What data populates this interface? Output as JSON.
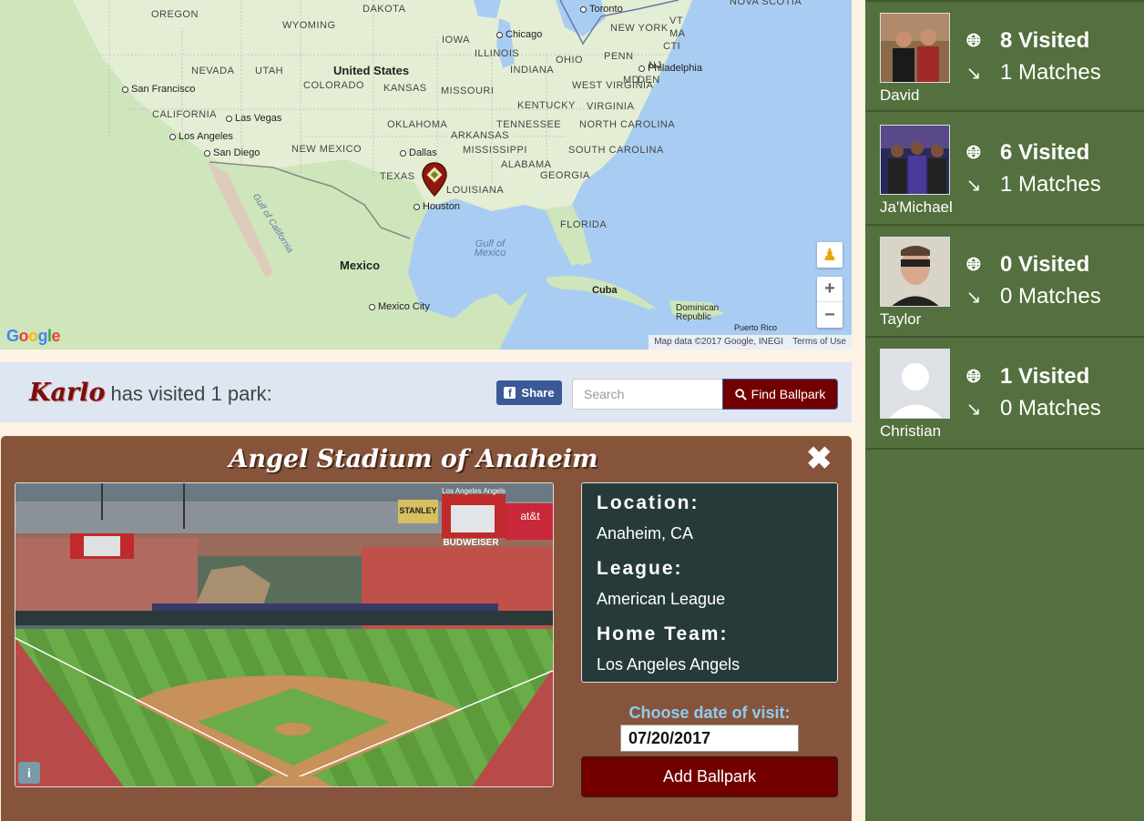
{
  "map": {
    "labels": {
      "oregon": "OREGON",
      "wyoming": "WYOMING",
      "dakota": "DAKOTA",
      "iowa": "IOWA",
      "nevada": "NEVADA",
      "utah": "UTAH",
      "colorado": "COLORADO",
      "kansas": "KANSAS",
      "missouri": "MISSOURI",
      "illinois": "ILLINOIS",
      "indiana": "INDIANA",
      "ohio": "OHIO",
      "penn": "PENN",
      "ny": "NEW YORK",
      "vt": "VT",
      "ma": "MA",
      "cti": "CTI",
      "nj": "NJ",
      "md": "MD",
      "de": "DEN",
      "california": "CALIFORNIA",
      "oklahoma": "OKLAHOMA",
      "tennessee": "TENNESSEE",
      "kentucky": "KENTUCKY",
      "westvirginia": "WEST VIRGINIA",
      "virginia": "VIRGINIA",
      "northcarolina": "NORTH CAROLINA",
      "southcarolina": "SOUTH CAROLINA",
      "arkansas": "ARKANSAS",
      "mississippi": "MISSISSIPPI",
      "alabama": "ALABAMA",
      "georgia": "GEORGIA",
      "newmexico": "NEW MEXICO",
      "texas": "TEXAS",
      "louisiana": "LOUISIANA",
      "florida": "FLORIDA",
      "novascotia": "NOVA SCOTIA",
      "us": "United States",
      "mexico": "Mexico",
      "cuba": "Cuba",
      "dr": "Dominican Republic",
      "pr": "Puerto Rico",
      "gulf": "Gulf of Mexico",
      "gulfcal": "Gulf of California",
      "chicago": "Chicago",
      "toronto": "Toronto",
      "philadelphia": "Philadelphia",
      "sanfrancisco": "San Francisco",
      "lasvegas": "Las Vegas",
      "losangeles": "Los Angeles",
      "sandiego": "San Diego",
      "dallas": "Dallas",
      "houston": "Houston",
      "mexicocity": "Mexico City"
    },
    "google": [
      "G",
      "o",
      "o",
      "g",
      "l",
      "e"
    ],
    "attribution": "Map data ©2017 Google, INEGI",
    "terms": "Terms of Use",
    "zoom_in": "+",
    "zoom_out": "−"
  },
  "banner": {
    "user_name": "Karlo",
    "visited_text": "has visited 1 park:",
    "share_label": "Share",
    "search_placeholder": "Search",
    "find_label": "Find Ballpark"
  },
  "park": {
    "name": "Angel Stadium of Anaheim",
    "close_symbol": "✖",
    "location_label": "Location:",
    "location_value": "Anaheim, CA",
    "league_label": "League:",
    "league_value": "American League",
    "team_label": "Home Team:",
    "team_value": "Los Angeles Angels",
    "date_label": "Choose date of visit:",
    "date_value": "07/20/2017",
    "add_label": "Add Ballpark",
    "photo_signs": {
      "stanley": "STANLEY",
      "angels": "Los Angeles Angels",
      "att": "at&t",
      "budweiser": "BUDWEISER"
    }
  },
  "friends": [
    {
      "name": "David",
      "visited": "8 Visited",
      "matches": "1 Matches"
    },
    {
      "name": "Ja'Michael",
      "visited": "6 Visited",
      "matches": "1 Matches"
    },
    {
      "name": "Taylor",
      "visited": "0 Visited",
      "matches": "0 Matches"
    },
    {
      "name": "Christian",
      "visited": "1 Visited",
      "matches": "0 Matches"
    }
  ],
  "colors": {
    "sidebar": "#53703e",
    "park_panel": "#86543a",
    "button_dark_red": "#730000",
    "facebook": "#3b5998"
  }
}
